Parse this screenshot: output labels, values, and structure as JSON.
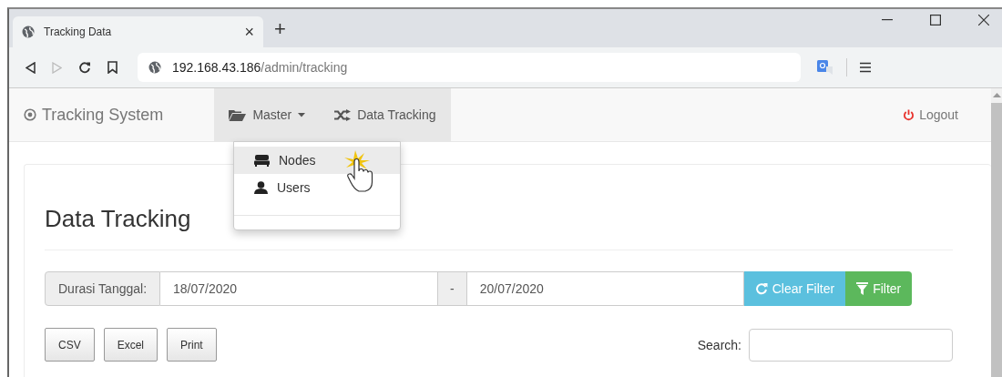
{
  "browser": {
    "tab_title": "Tracking Data",
    "new_tab": "+",
    "close_tab": "×",
    "address": "192.168.43.186",
    "address_path": "/admin/tracking"
  },
  "navbar": {
    "brand": "Tracking System",
    "items": [
      {
        "label": "Master",
        "kind": "dropdown",
        "expanded": true
      },
      {
        "label": "Data Tracking",
        "kind": "link",
        "selected": true
      }
    ],
    "logout": "Logout"
  },
  "dropdown": [
    {
      "label": "Nodes",
      "kind": "nodes",
      "highlighted": true
    },
    {
      "label": "Users",
      "kind": "users",
      "highlighted": false
    }
  ],
  "page": {
    "title": "Data Tracking",
    "filter": {
      "label": "Durasi Tanggal:",
      "from": "18/07/2020",
      "separator": "-",
      "to": "20/07/2020",
      "clear": "Clear Filter",
      "apply": "Filter"
    },
    "exports": [
      "CSV",
      "Excel",
      "Print"
    ],
    "search_label": "Search:"
  }
}
